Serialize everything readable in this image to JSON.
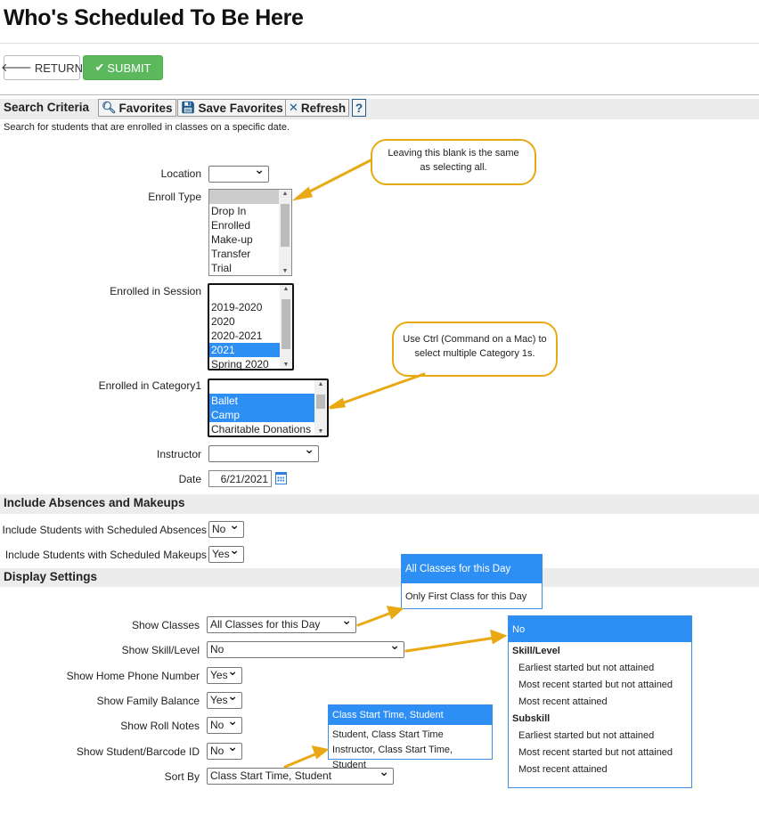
{
  "page": {
    "title": "Who's Scheduled To Be Here"
  },
  "buttons": {
    "return_label": "RETURN",
    "submit_label": "SUBMIT"
  },
  "toolbar": {
    "section_title": "Search Criteria",
    "favorites": "Favorites",
    "save_favorites": "Save Favorites",
    "refresh": "Refresh",
    "help": "?"
  },
  "description": "Search for students that are enrolled in classes on a specific date.",
  "criteria": {
    "location_label": "Location",
    "location_value": "",
    "enroll_type_label": "Enroll Type",
    "enroll_type_options": [
      "",
      "Drop In",
      "Enrolled",
      "Make-up",
      "Transfer",
      "Trial"
    ],
    "session_label": "Enrolled in Session",
    "session_options": [
      "",
      "2019-2020",
      "2020",
      "2020-2021",
      "2021",
      "Spring 2020"
    ],
    "category_label": "Enrolled in Category1",
    "category_options": [
      "Ballet",
      "Camp",
      "Charitable Donations"
    ],
    "instructor_label": "Instructor",
    "instructor_value": "",
    "date_label": "Date",
    "date_value": "6/21/2021"
  },
  "absences": {
    "section_title": "Include Absences and Makeups",
    "scheduled_absences_label": "Include Students with Scheduled Absences",
    "scheduled_absences_value": "No",
    "scheduled_makeups_label": "Include Students with Scheduled Makeups",
    "scheduled_makeups_value": "Yes"
  },
  "display": {
    "section_title": "Display Settings",
    "show_classes_label": "Show Classes",
    "show_classes_value": "All Classes for this Day",
    "show_skill_label": "Show Skill/Level",
    "show_skill_value": "No",
    "home_phone_label": "Show Home Phone Number",
    "home_phone_value": "Yes",
    "family_balance_label": "Show Family Balance",
    "family_balance_value": "Yes",
    "roll_notes_label": "Show Roll Notes",
    "roll_notes_value": "No",
    "barcode_label": "Show Student/Barcode ID",
    "barcode_value": "No",
    "sort_by_label": "Sort By",
    "sort_by_value": "Class Start Time, Student"
  },
  "callouts": {
    "enroll_type": "Leaving this blank is the same as selecting all.",
    "category": "Use Ctrl (Command on a Mac) to select multiple Category 1s."
  },
  "dropdowns": {
    "classes": [
      "All Classes for this Day",
      "Only First Class for this Day"
    ],
    "skill": {
      "selected": "No",
      "group1": "Skill/Level",
      "group1_items": [
        "Earliest started but not attained",
        "Most recent started but not attained",
        "Most recent attained"
      ],
      "group2": "Subskill",
      "group2_items": [
        "Earliest started but not attained",
        "Most recent started but not attained",
        "Most recent attained"
      ]
    },
    "sort": [
      "Class Start Time, Student",
      "Student, Class Start Time",
      "Instructor, Class Start Time, Student"
    ]
  },
  "colors": {
    "submit_green": "#5cb85c",
    "selection_blue": "#2d8ef4",
    "callout_border": "#e8a913",
    "section_bg": "#ececec"
  }
}
